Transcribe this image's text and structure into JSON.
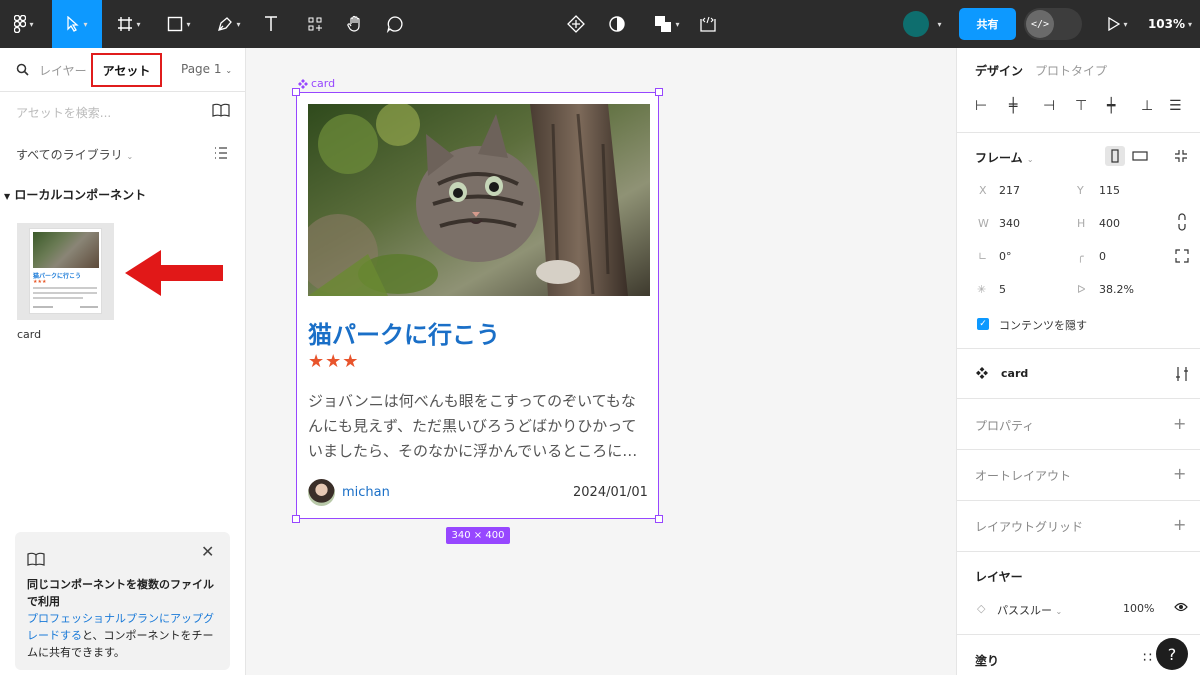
{
  "toolbar": {
    "zoom": "103%",
    "share_label": "共有",
    "dev_mode_glyph": "</>",
    "colors": {
      "bg": "#2c2c2c",
      "accent": "#0d99ff"
    }
  },
  "left_panel": {
    "tab_layers": "レイヤー",
    "tab_assets": "アセット",
    "page_label": "Page 1",
    "search_placeholder": "アセットを検索...",
    "library_label": "すべてのライブラリ",
    "local_components_label": "ローカルコンポーネント",
    "component": {
      "name": "card",
      "thumb_title": "猫パークに行こう",
      "thumb_stars": "★★★"
    },
    "promo": {
      "title": "同じコンポーネントを複数のファイルで利用",
      "link": "プロフェッショナルプランにアップグレードする",
      "rest": "と、コンポーネントをチームに共有できます。"
    }
  },
  "canvas": {
    "frame_label": "card",
    "size_badge": "340 × 400",
    "card": {
      "title": "猫パークに行こう",
      "stars": "★★★",
      "body": "ジョバンニは何べんも眼をこすってのぞいてもなんにも見えず、ただ黒いびろうどばかりひかっていましたら、そのなかに浮かんでいるところに…",
      "author": "michan",
      "date": "2024/01/01"
    }
  },
  "right_panel": {
    "tab_design": "デザイン",
    "tab_prototype": "プロトタイプ",
    "frame_label": "フレーム",
    "x_label": "X",
    "x": "217",
    "y_label": "Y",
    "y": "115",
    "w_label": "W",
    "w": "340",
    "h_label": "H",
    "h": "400",
    "rotation": "0°",
    "radius": "0",
    "count": "5",
    "ratio": "38.2%",
    "clip_label": "コンテンツを隠す",
    "component_name": "card",
    "sections": {
      "properties": "プロパティ",
      "auto_layout": "オートレイアウト",
      "layout_grid": "レイアウトグリッド",
      "layer": "レイヤー",
      "fill": "塗り"
    },
    "blend_mode": "パススルー",
    "opacity": "100%"
  },
  "help_label": "?"
}
